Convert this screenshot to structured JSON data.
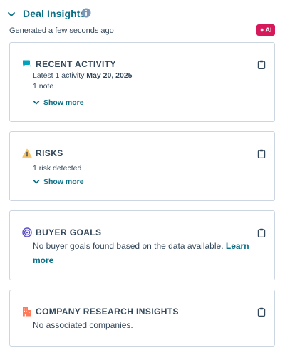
{
  "header": {
    "title": "Deal Insights",
    "generated": "Generated a few seconds ago",
    "ai_badge": "AI"
  },
  "cards": {
    "recent_activity": {
      "title": "RECENT ACTIVITY",
      "latest_prefix": "Latest 1 activity ",
      "latest_date": "May 20, 2025",
      "note_count": "1 note",
      "show_more": "Show more"
    },
    "risks": {
      "title": "RISKS",
      "detected": "1 risk detected",
      "show_more": "Show more"
    },
    "buyer_goals": {
      "title": "BUYER GOALS",
      "text": "No buyer goals found based on the data available. ",
      "learn_more": "Learn more"
    },
    "company_research": {
      "title": "COMPANY RESEARCH INSIGHTS",
      "text": "No associated companies."
    }
  },
  "colors": {
    "accent": "#0b6f85",
    "text": "#33475b",
    "border": "#cbd6e2",
    "ai_badge": "#d6195b",
    "activity_icon": "#00a4bd",
    "risk_icon": "#f5c26b",
    "goals_icon": "#5c4fc7",
    "company_icon": "#ff7a59"
  },
  "icons": {
    "collapse": "chevron-down-icon",
    "info": "info-icon",
    "ai": "sparkle-icon",
    "activity": "chat-bubbles-icon",
    "risk": "warning-icon",
    "goals": "target-icon",
    "company": "building-icon",
    "copy": "clipboard-icon"
  }
}
